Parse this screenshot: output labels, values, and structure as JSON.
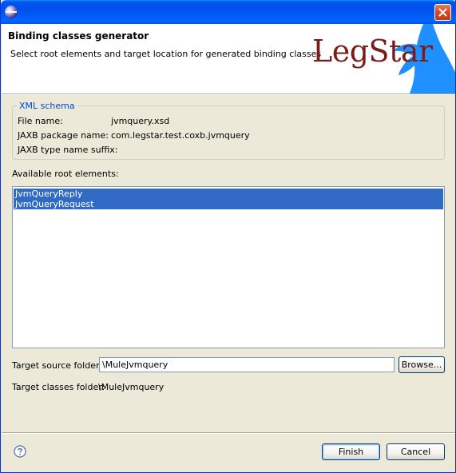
{
  "banner": {
    "title": "Binding classes generator",
    "description": "Select root elements and target location for generated binding classes",
    "logo_text": "LegStar"
  },
  "xml_schema": {
    "group_label": "XML schema",
    "file_name_label": "File name:",
    "file_name_value": "jvmquery.xsd",
    "jaxb_package_label": "JAXB package name:",
    "jaxb_package_value": "com.legstar.test.coxb.jvmquery",
    "jaxb_suffix_label": "JAXB type name suffix:",
    "jaxb_suffix_value": ""
  },
  "root_elements": {
    "label": "Available root elements:",
    "items": [
      "JvmQueryReply",
      "JvmQueryRequest"
    ]
  },
  "target_source": {
    "label": "Target source folder:",
    "value": "\\MuleJvmquery",
    "browse_label": "Browse..."
  },
  "target_classes": {
    "label": "Target classes folder:",
    "value": "\\MuleJvmquery"
  },
  "footer": {
    "finish_label": "Finish",
    "cancel_label": "Cancel"
  },
  "colors": {
    "selection": "#316ac5",
    "logo_text": "#7a1d1a",
    "logo_shape": "#1e90ff",
    "group_label": "#0046d5"
  }
}
